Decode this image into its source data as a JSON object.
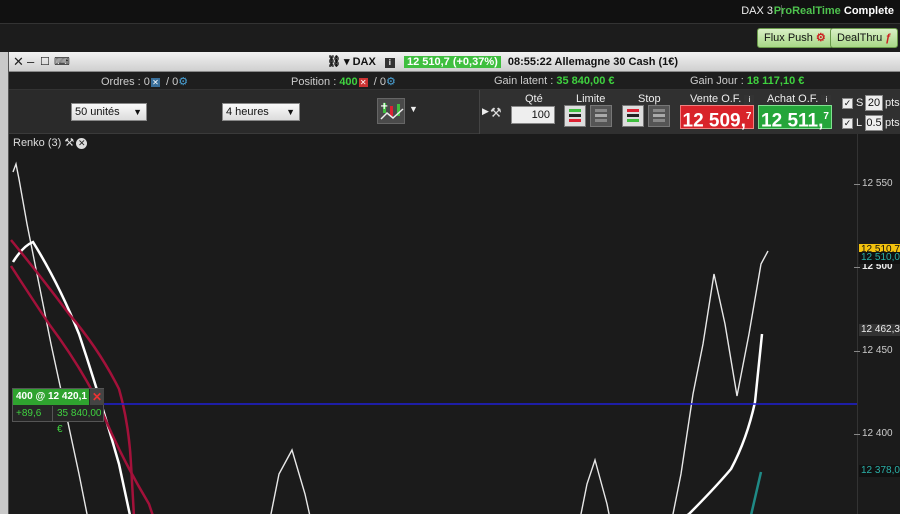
{
  "app": {
    "symbol": "DAX 3",
    "brand_pr": "ProRealTime",
    "brand_complete": "Complete",
    "flux_push": "Flux Push",
    "dealthru": "DealThru"
  },
  "window": {
    "instrument": "DAX",
    "quote": "12 510,7 (+0,37%)",
    "time_name": "08:55:22 Allemagne 30 Cash (1€)"
  },
  "stats": {
    "ordres_label": "Ordres :",
    "ordres_a": "0",
    "ordres_b": "0",
    "position_label": "Position :",
    "position_value": "400",
    "position_b": "0",
    "gain_latent_label": "Gain latent :",
    "gain_latent_value": "35 840,00 €",
    "gain_jour_label": "Gain Jour :",
    "gain_jour_value": "18 117,10 €"
  },
  "toolbar": {
    "units": "50 unités",
    "timeframe": "4 heures"
  },
  "order_panel": {
    "qty_label": "Qté",
    "qty_value": "100",
    "limite_label": "Limite",
    "stop_label": "Stop",
    "vente_label": "Vente O.F.",
    "achat_label": "Achat O.F.",
    "sell_price_main": "12 509,",
    "sell_price_sup": "7",
    "buy_price_main": "12 511,",
    "buy_price_sup": "7",
    "s_label": "S",
    "s_value": "20",
    "l_label": "L",
    "l_value": "0.5",
    "pts": "pts"
  },
  "chart": {
    "indicator_label": "Renko (3)",
    "position_box": {
      "header": "400 @ 12 420,1",
      "points": "+89,6",
      "gain": "35 840,00 €"
    },
    "y_ticks": [
      {
        "label": "12 550",
        "value": 12550,
        "bold": false
      },
      {
        "label": "12 500",
        "value": 12500,
        "bold": true
      },
      {
        "label": "12 450",
        "value": 12450,
        "bold": false
      },
      {
        "label": "12 400",
        "value": 12400,
        "bold": false
      }
    ],
    "price_tags": [
      {
        "label": "12 510,7",
        "value": 12510.7,
        "style": "yellow"
      },
      {
        "label": "12 510,0",
        "value": 12505.5,
        "style": "teal"
      },
      {
        "label": "12 462,3",
        "value": 12462.3,
        "style": "grey"
      },
      {
        "label": "12 378,0",
        "value": 12378,
        "style": "teal"
      }
    ],
    "colors": {
      "renko": "#e8e8e8",
      "ma_fast": "#ffffff",
      "ma_slow": "#a3113a",
      "position_line": "#1f1fd6",
      "teal": "#1f8a86"
    }
  }
}
